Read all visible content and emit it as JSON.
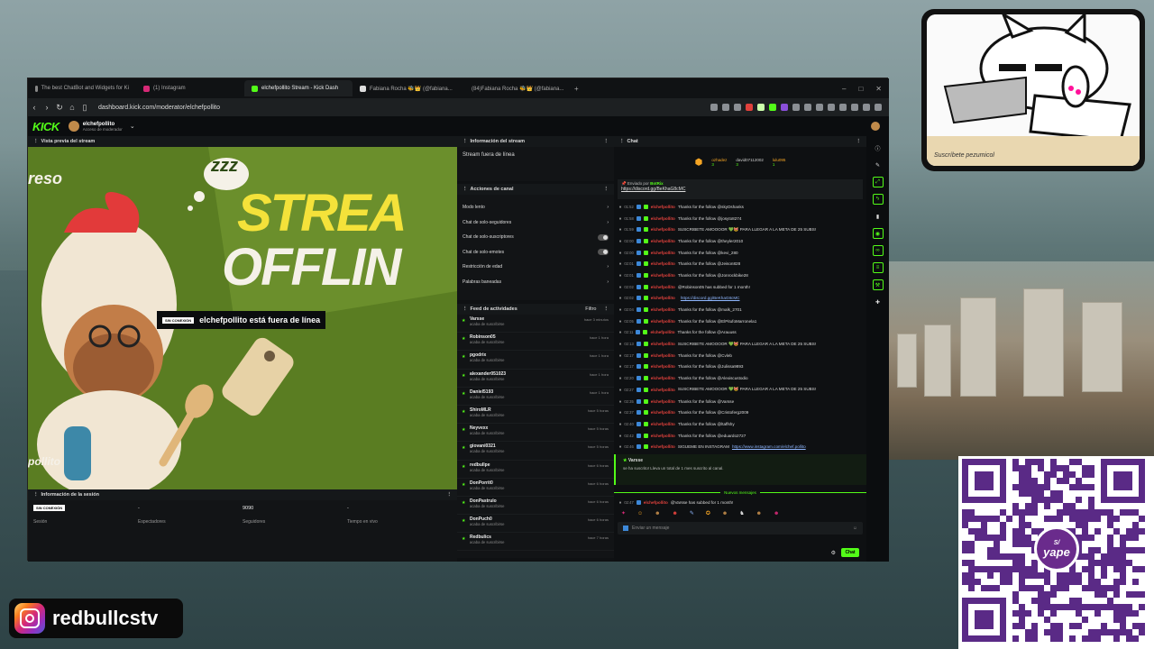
{
  "browser": {
    "tabs": [
      {
        "label": "The best ChatBot and Widgets for Ki",
        "color": "#888"
      },
      {
        "label": "(1) Instagram",
        "color": "#d62976"
      },
      {
        "label": "elchefpollito Stream - Kick Dash",
        "color": "#53fc18"
      },
      {
        "label": "Fabiana Rocha 🐝👑 (@fabiana...",
        "color": "#ddd"
      },
      {
        "label": "(84)Fabiana Rocha 🐝👑 (@fabiana...",
        "color": "#ddd"
      }
    ],
    "url": "dashboard.kick.com/moderator/elchefpollito"
  },
  "kick_header": {
    "logo": "KICK",
    "channel_name": "elchefpollito",
    "role": "Acceso de moderador"
  },
  "preview": {
    "title": "Vista previa del stream",
    "overlay_word_1": "STREA",
    "overlay_word_2": "OFFLIN",
    "overlay_left": "reso",
    "overlay_zzz": "zzz",
    "overlay_bottom": "pollito",
    "badge": "SIN CONEXIÓN",
    "offline_text": "elchefpollito está fuera de línea"
  },
  "session": {
    "title": "Información de la sesión",
    "cells": [
      {
        "value": "SIN CONEXIÓN",
        "label": "Sesión"
      },
      {
        "value": "-",
        "label": "Espectadores"
      },
      {
        "value": "9090",
        "label": "Seguidores"
      },
      {
        "value": "-",
        "label": "Tiempo en vivo"
      }
    ]
  },
  "stream_info": {
    "title": "Información del stream",
    "text": "Stream fuera de línea"
  },
  "channel_actions": {
    "title": "Acciones de canal",
    "items": [
      {
        "label": "Modo lento",
        "control": "chevron"
      },
      {
        "label": "Chat de solo-seguidores",
        "control": "chevron"
      },
      {
        "label": "Chat de solo-suscriptores",
        "control": "toggle"
      },
      {
        "label": "Chat de solo-emotes",
        "control": "toggle"
      },
      {
        "label": "Restricción de edad",
        "control": "chevron"
      },
      {
        "label": "Palabras baneadas",
        "control": "chevron"
      }
    ]
  },
  "activity_feed": {
    "title": "Feed de actividades",
    "filter": "Filtro",
    "items": [
      {
        "name": "Varsse",
        "sub": "acaba de suscribirse",
        "time": "hace 3 minutos"
      },
      {
        "name": "Robinson05",
        "sub": "acaba de suscribirse",
        "time": "hace 1 hora"
      },
      {
        "name": "pgodrix",
        "sub": "acaba de suscribirse",
        "time": "hace 1 hora"
      },
      {
        "name": "alexander051023",
        "sub": "acaba de suscribirse",
        "time": "hace 1 hora"
      },
      {
        "name": "Daniel5193",
        "sub": "acaba de suscribirse",
        "time": "hace 1 hora"
      },
      {
        "name": "ShiroMLR",
        "sub": "acaba de suscribirse",
        "time": "hace 5 horas"
      },
      {
        "name": "Neyvexx",
        "sub": "acaba de suscribirse",
        "time": "hace 5 horas"
      },
      {
        "name": "giovani0321",
        "sub": "acaba de suscribirse",
        "time": "hace 5 horas"
      },
      {
        "name": "redbullpe",
        "sub": "acaba de suscribirse",
        "time": "hace 6 horas"
      },
      {
        "name": "DonPorrit0",
        "sub": "acaba de suscribirse",
        "time": "hace 6 horas"
      },
      {
        "name": "DonPastrulo",
        "sub": "acaba de suscribirse",
        "time": "hace 6 horas"
      },
      {
        "name": "DonPuch0",
        "sub": "acaba de suscribirse",
        "time": "hace 6 horas"
      },
      {
        "name": "Redbulics",
        "sub": "acaba de suscribirse",
        "time": "hace 7 horas"
      }
    ]
  },
  "chat": {
    "title": "Chat",
    "leaders": [
      {
        "name": "ozhadez",
        "count": "3"
      },
      {
        "name": "david07112002",
        "count": "3"
      },
      {
        "name": "lulu095",
        "count": "1"
      }
    ],
    "pinned_by": "Enviado por",
    "pinned_user": "BotRix",
    "pinned_link": "https://discord.gg/BeKhaG8cMC",
    "messages": [
      {
        "time": "01:52",
        "user": "elchefpollito",
        "text": "Thanks for the follow @skyDshanks",
        "link": ""
      },
      {
        "time": "01:58",
        "user": "elchefpollito",
        "text": "Thanks for the follow @josyto8274",
        "link": ""
      },
      {
        "time": "01:59",
        "user": "elchefpollito",
        "text": "SUSCRIBETE AMOOOOR 💚😻 PARA LLEGAR A LA META DE 25 SUBS!",
        "link": ""
      },
      {
        "time": "02:00",
        "user": "elchefpollito",
        "text": "Thanks for the follow @theyler2010",
        "link": ""
      },
      {
        "time": "02:00",
        "user": "elchefpollito",
        "text": "Thanks for the follow @kevi_280",
        "link": ""
      },
      {
        "time": "02:01",
        "user": "elchefpollito",
        "text": "Thanks for the follow @Jeison828",
        "link": ""
      },
      {
        "time": "02:01",
        "user": "elchefpollito",
        "text": "Thanks for the follow @Jonrockbike28",
        "link": ""
      },
      {
        "time": "02:02",
        "user": "elchefpollito",
        "text": "@Robinson05 has subbed for 1 month!",
        "link": ""
      },
      {
        "time": "02:02",
        "user": "elchefpollito",
        "text": "",
        "link": "https://discord.gg/BeKhaG8cMC"
      },
      {
        "time": "02:04",
        "user": "elchefpollito",
        "text": "Thanks for the follow @malk_2701",
        "link": ""
      },
      {
        "time": "02:05",
        "user": "elchefpollito",
        "text": "Thanks for the follow @ElPitufoMarronela1",
        "link": ""
      },
      {
        "time": "02:11",
        "user": "elchefpollito",
        "text": "Thanks for the follow @Arauuss",
        "link": ""
      },
      {
        "time": "02:13",
        "user": "elchefpollito",
        "text": "SUSCRIBETE AMOOOOR 💚😻 PARA LLEGAR A LA META DE 25 SUBS!",
        "link": ""
      },
      {
        "time": "02:17",
        "user": "elchefpollito",
        "text": "Thanks for the follow @Cvleb",
        "link": ""
      },
      {
        "time": "02:17",
        "user": "elchefpollito",
        "text": "Thanks for the follow @Julissa9893",
        "link": ""
      },
      {
        "time": "02:20",
        "user": "elchefpollito",
        "text": "Thanks for the follow @Alexiscustodio",
        "link": ""
      },
      {
        "time": "02:27",
        "user": "elchefpollito",
        "text": "SUSCRIBETE AMOOOOR 💚😻 PARA LLEGAR A LA META DE 25 SUBS!",
        "link": ""
      },
      {
        "time": "02:35",
        "user": "elchefpollito",
        "text": "Thanks for the follow @Varsse",
        "link": ""
      },
      {
        "time": "02:37",
        "user": "elchefpollito",
        "text": "Thanks for the follow @Cristoferg2009",
        "link": ""
      },
      {
        "time": "02:40",
        "user": "elchefpollito",
        "text": "Thanks for the follow @ltaffshy",
        "link": ""
      },
      {
        "time": "02:42",
        "user": "elchefpollito",
        "text": "Thanks for the follow @eduardo2727",
        "link": ""
      },
      {
        "time": "02:46",
        "user": "elchefpollito",
        "text": "SIGUEME EN INSTAGRAM ",
        "link": "https://www.instagram.com/elchef.pollito"
      }
    ],
    "sub_name": "Varsse",
    "sub_text": "se ha suscrito! Lleva un total de 1 mes suscrito al canal.",
    "new_messages": "Nuevos mensajes",
    "last_message": {
      "time": "02:47",
      "user": "elchefpollito",
      "text": "@Varsse has subbed for 1 month!"
    },
    "input_placeholder": "Enviar un mensaje",
    "send_label": "Chat"
  },
  "overlay": {
    "cat_caption": "Suscríbete pezumicol",
    "yape_label": "yape",
    "yape_badge": "S/",
    "instagram_handle": "redbullcstv"
  }
}
